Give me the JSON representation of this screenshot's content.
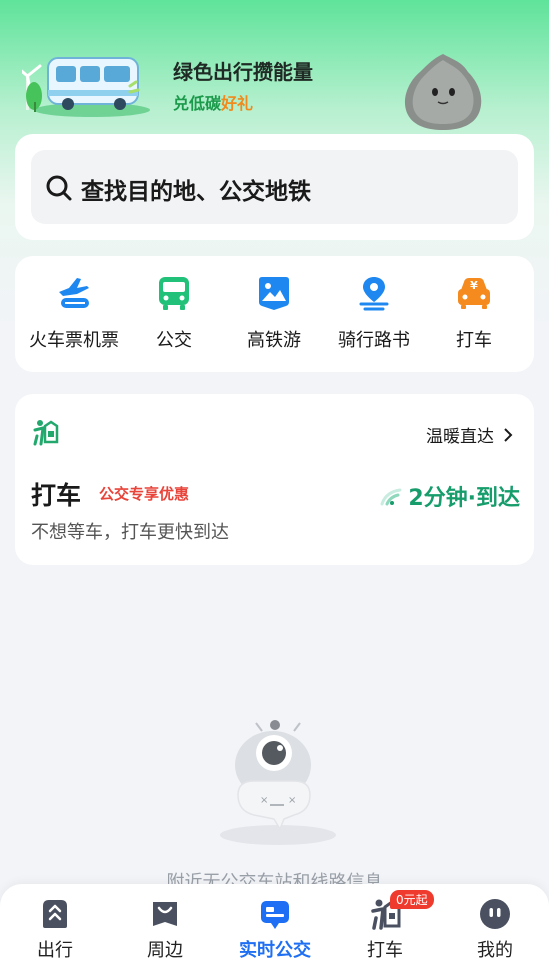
{
  "banner": {
    "title": "绿色出行攒能量",
    "subtitle_green": "兑低碳",
    "subtitle_orange": "好礼"
  },
  "search": {
    "placeholder": "查找目的地、公交地铁"
  },
  "services": [
    {
      "label": "火车票机票",
      "icon": "plane-train-icon",
      "color": "#1e88f0"
    },
    {
      "label": "公交",
      "icon": "bus-icon",
      "color": "#22c17a"
    },
    {
      "label": "高铁游",
      "icon": "picture-icon",
      "color": "#1e88f0"
    },
    {
      "label": "骑行路书",
      "icon": "location-route-icon",
      "color": "#1e88f0"
    },
    {
      "label": "打车",
      "icon": "taxi-icon",
      "color": "#f58a1f"
    }
  ],
  "taxi_card": {
    "link": "温暖直达",
    "title": "打车",
    "promo": "公交专享优惠",
    "eta": "2分钟·到达",
    "description": "不想等车，打车更快到达"
  },
  "empty_state": {
    "text": "附近无公交车站和线路信息"
  },
  "tabbar": {
    "tabs": [
      {
        "label": "出行",
        "icon": "travel-icon"
      },
      {
        "label": "周边",
        "icon": "nearby-icon"
      },
      {
        "label": "实时公交",
        "icon": "realtime-bus-icon",
        "active": true
      },
      {
        "label": "打车",
        "icon": "taxi-person-icon",
        "badge": "0元起"
      },
      {
        "label": "我的",
        "icon": "profile-icon"
      }
    ]
  },
  "colors": {
    "accent_blue": "#1e6ff3",
    "eta_green": "#179c6c",
    "promo_red": "#e8443a",
    "banner_green": "#5fe39a"
  }
}
